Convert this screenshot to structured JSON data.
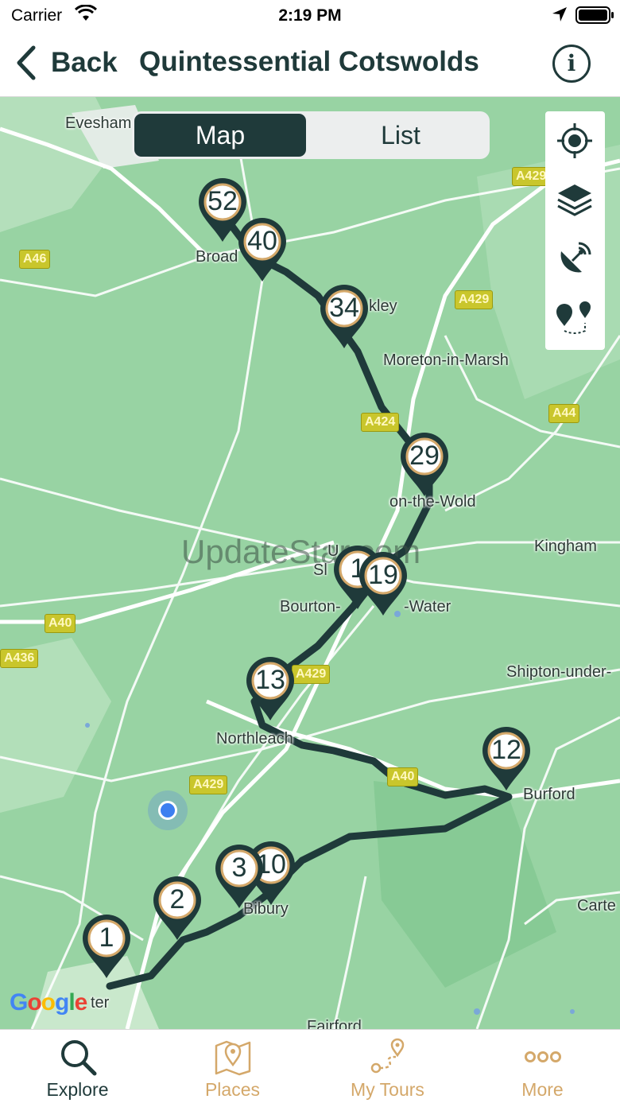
{
  "status_bar": {
    "carrier": "Carrier",
    "time": "2:19 PM"
  },
  "nav": {
    "back_label": "Back",
    "title": "Quintessential Cotswolds",
    "info_glyph": "i"
  },
  "segmented": {
    "map": "Map",
    "list": "List",
    "selected": "Map"
  },
  "map_tools": [
    "locate-icon",
    "layers-icon",
    "satellite-dish-icon",
    "route-pins-icon"
  ],
  "places": {
    "evesham": "Evesham",
    "broadway": "Broad",
    "blockley": "kley",
    "moreton": "Moreton-in-Marsh",
    "stow": "on-the-Wold",
    "kingham": "Kingham",
    "bourton_a": "Bourton-",
    "bourton_b": "-Water",
    "shipton": "Shipton-under-",
    "northleach": "Northleach",
    "burford": "Burford",
    "bibury": "Bibury",
    "carterton": "Carte",
    "cirencester": "ter",
    "fairford": "Fairford",
    "upper": "U",
    "slaughter": "Sl"
  },
  "roads": {
    "a46": "A46",
    "a429_top": "A429",
    "a429_mid": "A429",
    "a424": "A424",
    "a44": "A44",
    "a40_left": "A40",
    "a436": "A436",
    "a429_low": "A429",
    "a40_mid": "A40",
    "a429_bottom": "A429"
  },
  "watermark": "UpdateStar.com",
  "pins": {
    "p52": "52",
    "p40": "40",
    "p34": "34",
    "p29": "29",
    "p19": "19",
    "p1x": "1",
    "p13": "13",
    "p12": "12",
    "p10": "10",
    "p3": "3",
    "p2": "2",
    "p1": "1"
  },
  "map_attribution": "Google",
  "tabs": [
    {
      "label": "Explore",
      "icon": "search-icon",
      "active": true
    },
    {
      "label": "Places",
      "icon": "map-pin-icon",
      "active": false
    },
    {
      "label": "My Tours",
      "icon": "route-icon",
      "active": false
    },
    {
      "label": "More",
      "icon": "more-dots-icon",
      "active": false
    }
  ],
  "colors": {
    "primary": "#1f3a3a",
    "accent": "#d4a86a",
    "map_green": "#98d3a3",
    "route": "#1f3a3a",
    "user_location": "#3d7ff0"
  }
}
